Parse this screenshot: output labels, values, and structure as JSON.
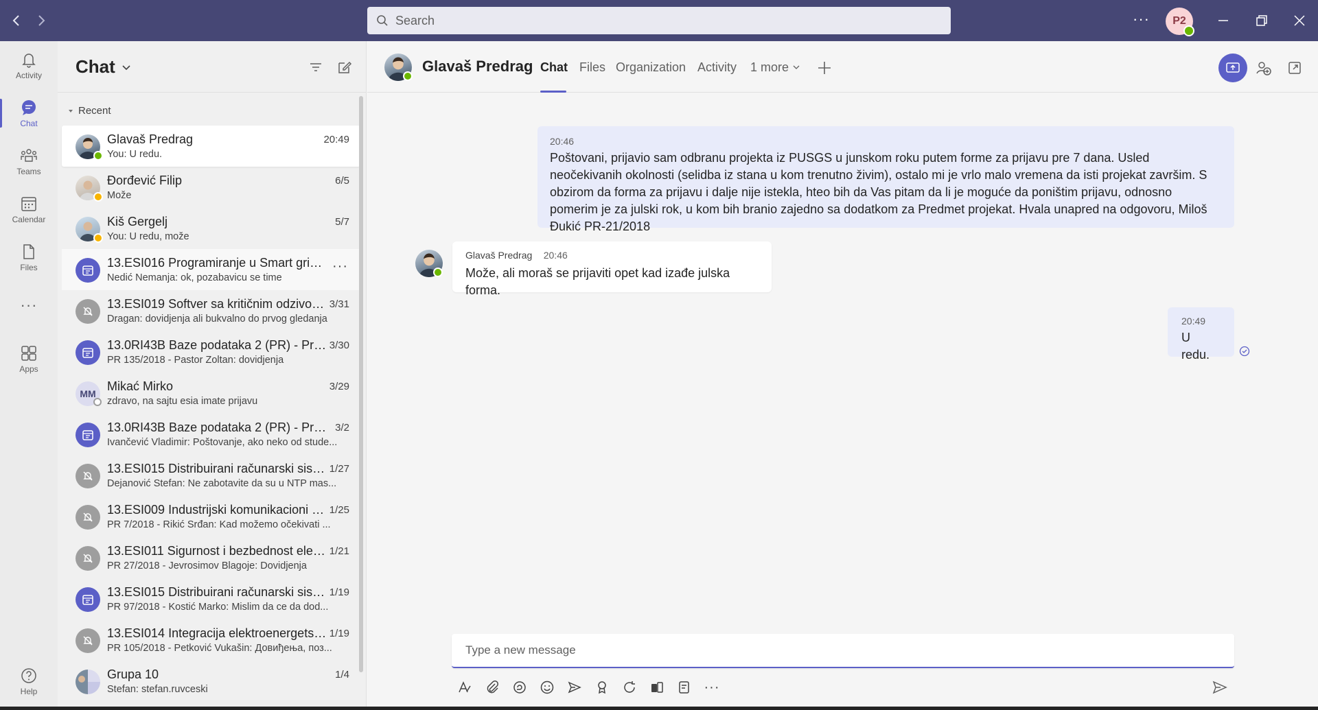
{
  "search": {
    "placeholder": "Search"
  },
  "top": {
    "avatar_initials": "P2",
    "more": "···"
  },
  "rail": {
    "items": [
      {
        "label": "Activity",
        "icon": "bell-icon"
      },
      {
        "label": "Chat",
        "icon": "chat-icon"
      },
      {
        "label": "Teams",
        "icon": "teams-icon"
      },
      {
        "label": "Calendar",
        "icon": "calendar-icon"
      },
      {
        "label": "Files",
        "icon": "file-icon"
      },
      {
        "label": "Apps",
        "icon": "apps-icon"
      },
      {
        "label": "Help",
        "icon": "help-icon"
      }
    ],
    "more": "···"
  },
  "chatlist": {
    "title": "Chat",
    "section": "Recent",
    "items": [
      {
        "name": "Glavaš Predrag",
        "preview": "You: U redu.",
        "time": "20:49"
      },
      {
        "name": "Đorđević Filip",
        "preview": "Može",
        "time": "6/5"
      },
      {
        "name": "Kiš Gergelj",
        "preview": "You: U redu, može",
        "time": "5/7"
      },
      {
        "name": "13.ESI016 Programiranje u Smart grid si...",
        "preview": "Nedić Nemanja: ok, pozabavicu se time",
        "time": ""
      },
      {
        "name": "13.ESI019 Softver sa kritičnim odzivom ...",
        "preview": "Dragan: dovidjenja ali bukvalno do prvog gledanja",
        "time": "3/31"
      },
      {
        "name": "13.0RI43B Baze podataka 2 (PR) - Pred...",
        "preview": "PR 135/2018 - Pastor Zoltan: dovidjenja",
        "time": "3/30"
      },
      {
        "name": "Mikać Mirko",
        "preview": "zdravo, na sajtu esia imate prijavu",
        "time": "3/29",
        "initials": "MM"
      },
      {
        "name": "13.0RI43B Baze podataka 2 (PR) - Preda...",
        "preview": "Ivančević Vladimir: Poštovanje, ako neko od stude...",
        "time": "3/2"
      },
      {
        "name": "13.ESI015 Distribuirani računarski siste...",
        "preview": "Dejanović Stefan: Ne zabotavite da su u NTP mas...",
        "time": "1/27"
      },
      {
        "name": "13.ESI009 Industrijski komunikacioni pr...",
        "preview": "PR 7/2018 - Rikić Srđan: Kad možemo očekivati ...",
        "time": "1/25"
      },
      {
        "name": "13.ESI011 Sigurnost i bezbednost elekt...",
        "preview": "PR 27/2018 - Jevrosimov Blagoje: Dovidjenja",
        "time": "1/21"
      },
      {
        "name": "13.ESI015 Distribuirani računarski siste...",
        "preview": "PR 97/2018 - Kostić Marko: Mislim da ce da dod...",
        "time": "1/19"
      },
      {
        "name": "13.ESI014 Integracija elektroenergetski...",
        "preview": "PR 105/2018 - Petković Vukašin: Довиђења, поз...",
        "time": "1/19"
      },
      {
        "name": "Grupa 10",
        "preview": "Stefan: stefan.ruvceski",
        "time": "1/4"
      }
    ]
  },
  "conversation": {
    "name": "Glavaš Predrag",
    "tabs": [
      "Chat",
      "Files",
      "Organization",
      "Activity",
      "1 more"
    ],
    "messages": [
      {
        "from": "me",
        "time": "20:46",
        "text": "Poštovani, prijavio sam odbranu projekta iz PUSGS u junskom roku putem forme za prijavu pre 7 dana. Usled neočekivanih okolnosti (selidba iz stana u kom trenutno živim), ostalo mi je vrlo malo vremena da isti projekat završim. S obzirom da forma za prijavu i dalje nije istekla, hteo bih da Vas pitam da li je moguće da poništim prijavu, odnosno pomerim je za julski rok, u kom bih branio zajedno sa dodatkom za Predmet projekat. Hvala unapred na odgovoru, Miloš Đukić PR-21/2018"
      },
      {
        "from": "them",
        "sender": "Glavaš Predrag",
        "time": "20:46",
        "text": "Može, ali moraš se prijaviti opet kad izađe julska forma."
      },
      {
        "from": "me",
        "time": "20:49",
        "text": "U redu."
      }
    ],
    "composer_placeholder": "Type a new message"
  },
  "colors": {
    "brand": "#464775",
    "accent": "#5b5fc7",
    "my_bubble": "#e8ebfa",
    "presence_available": "#6bb700",
    "presence_away": "#f8b400"
  }
}
